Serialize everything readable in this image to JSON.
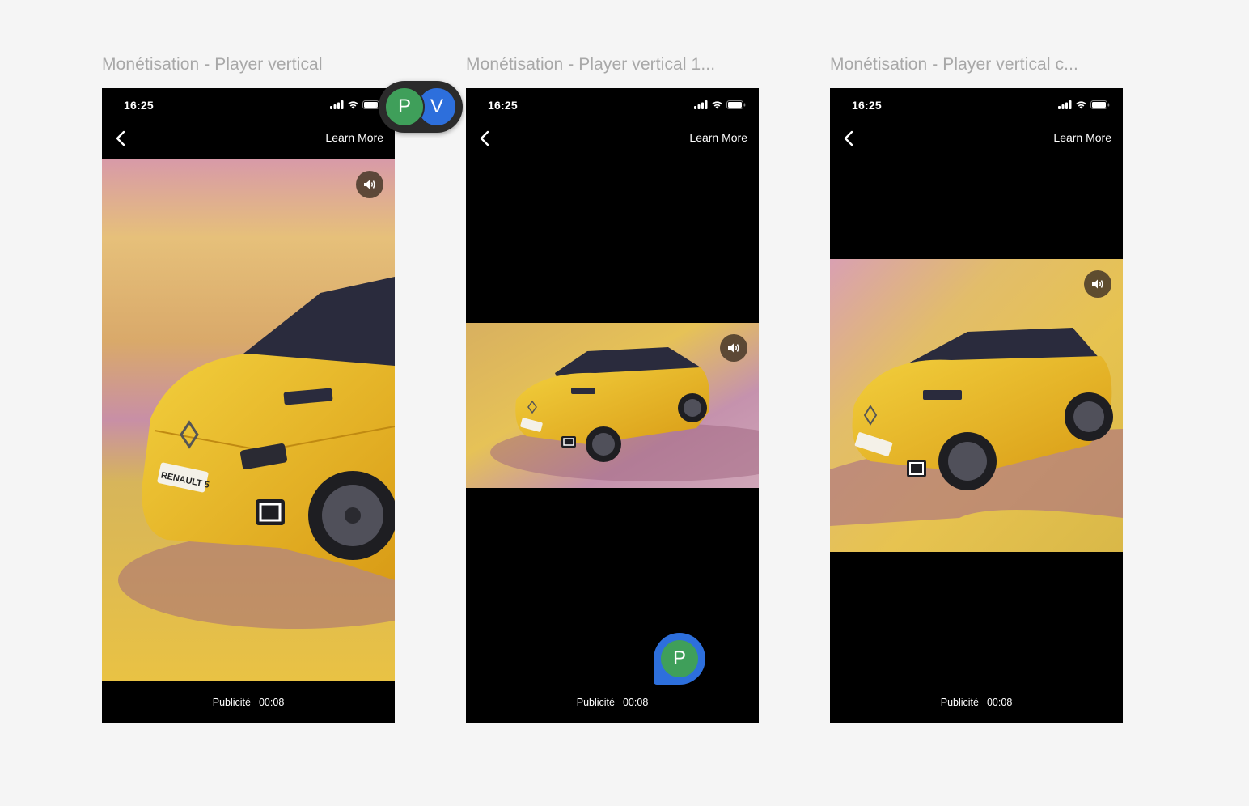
{
  "frames": [
    {
      "title": "Monétisation - Player vertical",
      "status_time": "16:25",
      "learn_more": "Learn More",
      "ad_label": "Publicité",
      "ad_timer": "00:08",
      "media_kind": "vertical-crop"
    },
    {
      "title": "Monétisation - Player vertical 1...",
      "status_time": "16:25",
      "learn_more": "Learn More",
      "ad_label": "Publicité",
      "ad_timer": "00:08",
      "media_kind": "landscape-16-9"
    },
    {
      "title": "Monétisation - Player vertical c...",
      "status_time": "16:25",
      "learn_more": "Learn More",
      "ad_label": "Publicité",
      "ad_timer": "00:08",
      "media_kind": "square"
    }
  ],
  "collaborators": {
    "group": [
      "P",
      "V"
    ],
    "comment_pin": "P"
  },
  "car_plate": "RENAULT 5",
  "colors": {
    "canvas_bg": "#f5f5f5",
    "title_gray": "#a8a8a8",
    "phone_bg": "#000000",
    "car_yellow": "#e8b825",
    "avatar_green": "#3f9f5a",
    "avatar_blue": "#2d6fdc"
  },
  "icons": [
    "back-chevron-icon",
    "signal-icon",
    "wifi-icon",
    "battery-icon",
    "speaker-icon"
  ]
}
